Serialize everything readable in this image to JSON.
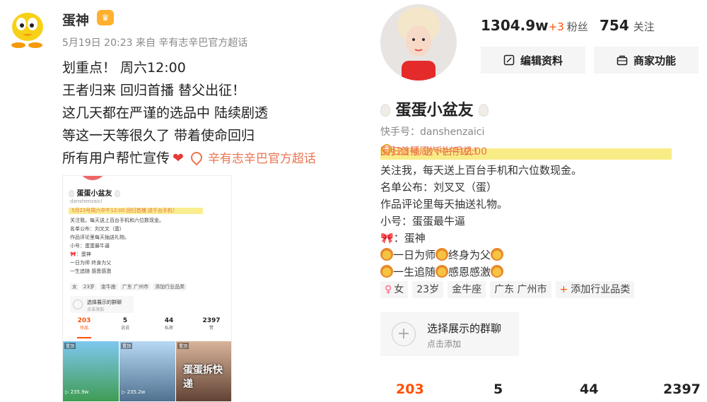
{
  "post": {
    "username": "蛋神",
    "meta": "5月19日 20:23 来自 辛有志辛巴官方超话",
    "lines": [
      "划重点！ 周六12:00",
      "王者归来 回归首播 替父出征！",
      "这几天都在严谨的选品中 陆续剧透",
      "等这一天等很久了 带着使命回归",
      "所有用户帮忙宣传"
    ],
    "topic": "辛有志辛巴官方超话",
    "icons": {
      "heart": "heart-icon",
      "vip": "vip-badge-icon",
      "topic": "topic-icon"
    }
  },
  "mini": {
    "name": "蛋蛋小盆友",
    "id": "danshenzaici",
    "highlight": "5月23号周六中午12:00 回归首播 送千台手机！",
    "bio": [
      "关注我，每天送上百台手机和六位数现金。",
      "名单公布：刘叉叉（蛋）",
      "作品评论里每天抽送礼物。",
      "小号：蛋蛋最牛逼",
      "：蛋神",
      "一日为师 终身为父",
      "一生追随 感恩感激"
    ],
    "tags": [
      "女",
      "23岁",
      "金牛座",
      "广东 广州市",
      "添加行业品类"
    ],
    "group_title": "选择展示的群聊",
    "group_sub": "点击添加",
    "stats": [
      {
        "n": "203",
        "l": "作品"
      },
      {
        "n": "5",
        "l": "说说"
      },
      {
        "n": "44",
        "l": "私密"
      },
      {
        "n": "2397",
        "l": "赞"
      }
    ],
    "thumbs": [
      {
        "tag": "置顶",
        "views": "▷ 235.9w",
        "cap": ""
      },
      {
        "tag": "置顶",
        "views": "▷ 235.2w",
        "cap": ""
      },
      {
        "tag": "置顶",
        "views": "",
        "cap": "蛋蛋拆快递"
      }
    ]
  },
  "profile": {
    "fans": "1304.9w",
    "fans_delta": "+3",
    "fans_label": "粉丝",
    "follow": "754",
    "follow_label": "关注",
    "edit_btn": "编辑资料",
    "biz_btn": "商家功能",
    "name": "蛋蛋小盆友",
    "kuaishou_id": "快手号：danshenzaici",
    "highlight_a": "5月23号周六中午12:00",
    "highlight_b": "回归首播 送千台手机！",
    "bio": [
      "关注我，每天送上百台手机和六位数现金。",
      "名单公布：刘叉叉（蛋）",
      "作品评论里每天抽送礼物。",
      "小号：蛋蛋最牛逼"
    ],
    "bio_ribbon_text": "：蛋神",
    "bio_lion1": "一日为师",
    "bio_lion1b": "终身为父",
    "bio_lion2": "一生追随",
    "bio_lion2b": "感恩感激",
    "tags": {
      "gender": "女",
      "age": "23岁",
      "zodiac": "金牛座",
      "location": "广东 广州市",
      "add": "添加行业品类"
    },
    "group_title": "选择展示的群聊",
    "group_sub": "点击添加",
    "stats": [
      "203",
      "5",
      "44",
      "2397"
    ],
    "accent": "#ff5000",
    "highlight_color": "#f8ec86"
  }
}
